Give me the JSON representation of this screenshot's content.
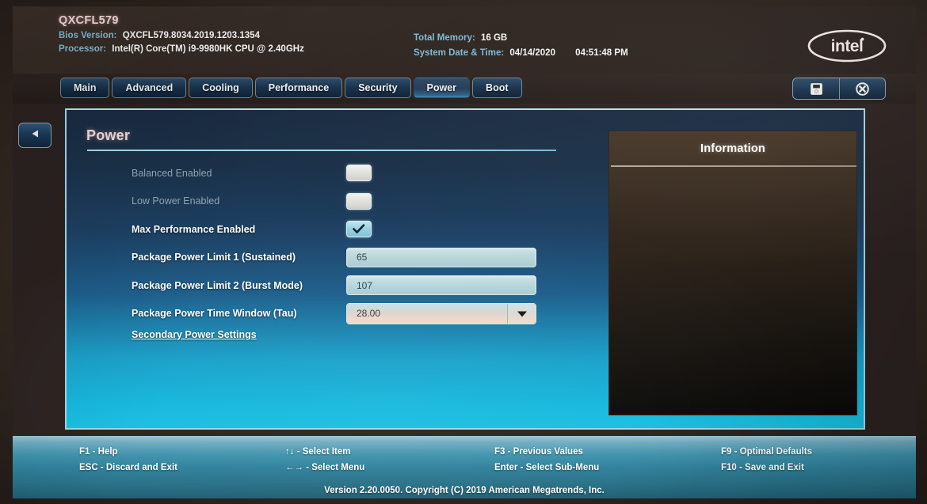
{
  "header": {
    "board_id": "QXCFL579",
    "bios_version_label": "Bios Version:",
    "bios_version_value": "QXCFL579.8034.2019.1203.1354",
    "processor_label": "Processor:",
    "processor_value": "Intel(R) Core(TM) i9-9980HK CPU @ 2.40GHz",
    "total_memory_label": "Total Memory:",
    "total_memory_value": "16 GB",
    "system_datetime_label": "System Date & Time:",
    "system_date_value": "04/14/2020",
    "system_time_value": "04:51:48 PM",
    "logo": "intel-logo"
  },
  "tabs": [
    {
      "label": "Main",
      "active": false
    },
    {
      "label": "Advanced",
      "active": false
    },
    {
      "label": "Cooling",
      "active": false
    },
    {
      "label": "Performance",
      "active": false
    },
    {
      "label": "Security",
      "active": false
    },
    {
      "label": "Power",
      "active": true
    },
    {
      "label": "Boot",
      "active": false
    }
  ],
  "window_buttons": [
    {
      "name": "save-icon",
      "label": "Save"
    },
    {
      "name": "exit-icon",
      "label": "Exit"
    }
  ],
  "collapse_button": {
    "icon": "chevron-left-icon"
  },
  "main": {
    "heading": "Power",
    "settings": [
      {
        "label": "Balanced Enabled",
        "control": "checkbox",
        "checked": false,
        "dimmed": true
      },
      {
        "label": "Low Power Enabled",
        "control": "checkbox",
        "checked": false,
        "dimmed": true
      },
      {
        "label": "Max Performance Enabled",
        "control": "checkbox",
        "checked": true,
        "dimmed": false
      },
      {
        "label": "Package Power Limit 1 (Sustained)",
        "control": "input",
        "value": "65",
        "dimmed": false
      },
      {
        "label": "Package Power Limit 2 (Burst Mode)",
        "control": "input",
        "value": "107",
        "dimmed": false
      },
      {
        "label": "Package Power Time Window (Tau)",
        "control": "dropdown",
        "value": "28.00",
        "dimmed": false
      }
    ],
    "secondary_link": "Secondary Power Settings"
  },
  "information": {
    "title": "Information",
    "body": ""
  },
  "footer": {
    "hints": [
      [
        {
          "key": "F1",
          "desc": "- Help"
        },
        {
          "key": "ESC",
          "desc": "- Discard and Exit"
        }
      ],
      [
        {
          "key": "↑↓",
          "desc": "- Select Item"
        },
        {
          "key": "←→",
          "desc": "- Select Menu"
        }
      ],
      [
        {
          "key": "F3",
          "desc": "- Previous Values"
        },
        {
          "key": "Enter",
          "desc": "- Select Sub-Menu"
        }
      ],
      [
        {
          "key": "F9",
          "desc": "- Optimal Defaults"
        },
        {
          "key": "F10",
          "desc": "- Save and Exit"
        }
      ]
    ],
    "version": "Version 2.20.0050. Copyright (C) 2019 American Megatrends, Inc."
  },
  "colors": {
    "accent_cyan": "#17bfe2",
    "panel_dark_navy": "#1a2b41",
    "heading_pink": "#f6d9da",
    "label_blue": "#7fb8d8",
    "footer_teal": "#2e7f9a",
    "info_brown": "#463729"
  }
}
